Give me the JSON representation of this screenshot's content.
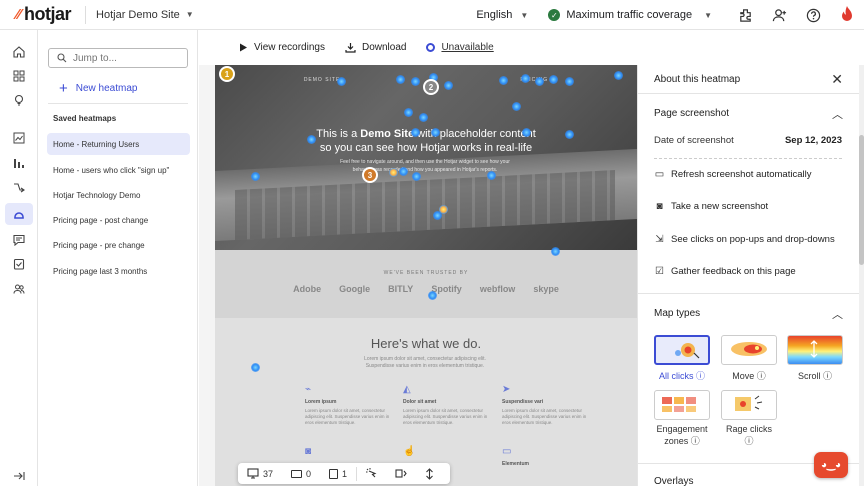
{
  "app": {
    "brand": "hotjar",
    "brand_color": "#f0582a",
    "accent_color": "#3c4cd4"
  },
  "topbar": {
    "site": "Hotjar Demo Site",
    "language": "English",
    "coverage": "Maximum traffic coverage",
    "icons": [
      "integrations-icon",
      "invite-user-icon",
      "help-icon",
      "hotjar-flame-icon"
    ]
  },
  "leftnav": {
    "icons": [
      "home-icon",
      "dashboard-icon",
      "insights-icon",
      "trends-icon",
      "funnels-icon",
      "journeys-icon",
      "heatmaps-icon",
      "feedback-icon",
      "surveys-icon",
      "users-icon",
      "expand-icon"
    ],
    "active": "heatmaps-icon"
  },
  "sidebar": {
    "search_placeholder": "Jump to...",
    "new_heatmap": "New heatmap",
    "saved_title": "Saved heatmaps",
    "items": [
      "Home - Returning Users",
      "Home - users who click \"sign up\"",
      "Hotjar Technology Demo",
      "Pricing page - post change",
      "Pricing page - pre change",
      "Pricing page last 3 months"
    ],
    "active_index": 0
  },
  "toolbar": {
    "view_recordings": "View recordings",
    "download": "Download",
    "unavailable": "Unavailable"
  },
  "screenshot": {
    "nav_left": "DEMO SITE",
    "nav_right": "PRICING",
    "hero_line1_pre": "This is a ",
    "hero_line1_bold": "Demo Site",
    "hero_line1_post": " with placeholder content",
    "hero_line2": "so you can see how Hotjar works in real-life",
    "hero_sub": "Feel free to navigate around, and then use the Hotjar widget to see how your behavior was recorded and how you appeared in Hotjar's reports.",
    "trusted_title": "WE'VE BEEN TRUSTED BY",
    "logos": [
      "Adobe",
      "Google",
      "BITLY",
      "Spotify",
      "webflow",
      "skype"
    ],
    "wwd_title": "Here's what we do.",
    "wwd_sub": "Lorem ipsum dolor sit amet, consectetur adipiscing elit. Suspendisse varius enim in eros elementum tristique.",
    "features": [
      {
        "title": "Lorem ipsum",
        "text": "Lorem ipsum dolor sit amet, consectetur adipiscing elit. Suspendisse varius enim in eros elementum tristique."
      },
      {
        "title": "Dolor sit amet",
        "text": "Lorem ipsum dolor sit amet, consectetur adipiscing elit. Suspendisse varius enim in eros elementum tristique."
      },
      {
        "title": "Suspendisse vari",
        "text": "Lorem ipsum dolor sit amet, consectetur adipiscing elit. Suspendisse varius enim in eros elementum tristique."
      },
      {
        "title": "",
        "text": ""
      },
      {
        "title": "",
        "text": ""
      },
      {
        "title": "Elementum",
        "text": ""
      }
    ],
    "markers": [
      {
        "label": "1",
        "color": "#d9a21a"
      },
      {
        "label": "2",
        "color": "#888888"
      },
      {
        "label": "3",
        "color": "#d07a2a"
      }
    ]
  },
  "bottombar": {
    "desktop_count": "37",
    "tablet_count": "0",
    "mobile_count": "1"
  },
  "panel": {
    "title": "About this heatmap",
    "page_screenshot": "Page screenshot",
    "date_label": "Date of screenshot",
    "date_value": "Sep 12, 2023",
    "refresh": "Refresh screenshot automatically",
    "new_screenshot": "Take a new screenshot",
    "popups": "See clicks on pop-ups and drop-downs",
    "gather": "Gather feedback on this page",
    "map_types": "Map types",
    "types": [
      {
        "label": "All clicks",
        "info": "ⓘ",
        "selected": true
      },
      {
        "label": "Move",
        "info": "ⓘ",
        "selected": false
      },
      {
        "label": "Scroll",
        "info": "ⓘ",
        "selected": false
      },
      {
        "label": "Engagement zones",
        "info": "ⓘ",
        "selected": false
      },
      {
        "label": "Rage clicks",
        "info": "ⓘ",
        "selected": false
      }
    ],
    "overlays": "Overlays"
  }
}
